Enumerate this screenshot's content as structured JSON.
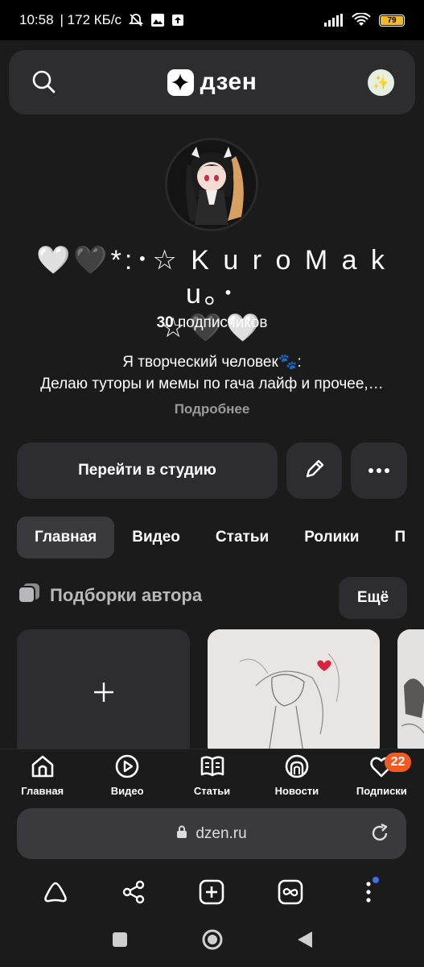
{
  "status_bar": {
    "time": "10:58",
    "speed": "| 172 КБ/с",
    "battery": "79"
  },
  "header": {
    "logo_text": "дзен"
  },
  "channel": {
    "name_line1": "🤍🖤*:･☆ K u r o M a k u｡･",
    "name_line2": "☆🖤🤍",
    "subscribers_count": "30",
    "subscribers_label": "подписчиков",
    "description_line1": "Я творческий человек🐾:",
    "description_line2": "Делаю туторы и мемы по гача лайф и прочее,…",
    "more_link": "Подробнее"
  },
  "actions": {
    "studio_button": "Перейти в студию"
  },
  "tabs": [
    {
      "label": "Главная",
      "active": true
    },
    {
      "label": "Видео"
    },
    {
      "label": "Статьи"
    },
    {
      "label": "Ролики"
    },
    {
      "label": "П"
    }
  ],
  "section": {
    "title": "Подборки автора",
    "all_button": "Ещё"
  },
  "bottom_nav": [
    {
      "label": "Главная",
      "icon": "home-icon"
    },
    {
      "label": "Видео",
      "icon": "play-icon"
    },
    {
      "label": "Статьи",
      "icon": "book-icon"
    },
    {
      "label": "Новости",
      "icon": "news-icon"
    },
    {
      "label": "Подписки",
      "icon": "subscriptions-icon",
      "badge": "22"
    }
  ],
  "browser": {
    "url": "dzen.ru"
  },
  "colors": {
    "background": "#1b1b1c",
    "surface": "#2d2d2f",
    "badge": "#f05a24",
    "battery": "#f5b631"
  }
}
